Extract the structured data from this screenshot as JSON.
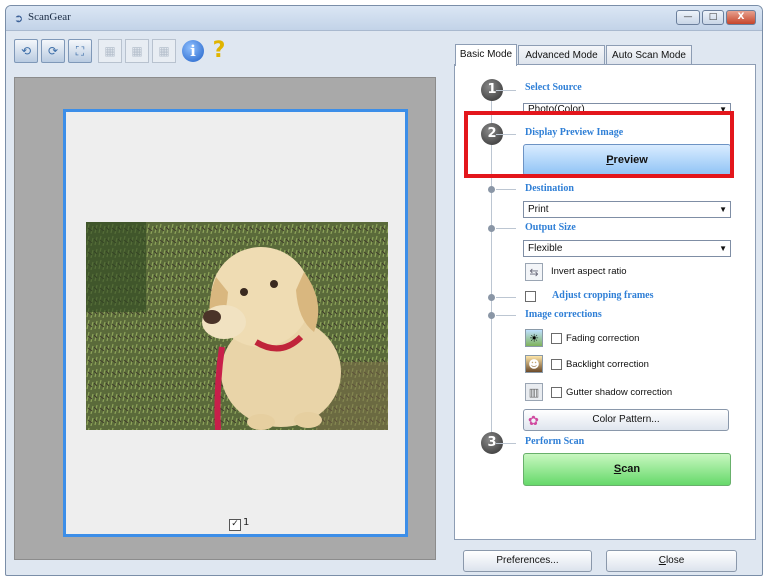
{
  "window": {
    "title": "ScanGear",
    "title_icon": "scanner-icon"
  },
  "title_buttons": {
    "minimize": "—",
    "maximize": "□",
    "close": "X"
  },
  "toolbar": {
    "icons": [
      "rotate-left-icon",
      "rotate-right-icon",
      "auto-crop-icon",
      "thumbnail-view-icon",
      "whole-image-view-icon",
      "clear-cropping-icon",
      "info-icon",
      "help-icon"
    ],
    "info_glyph": "i",
    "help_glyph": "?"
  },
  "preview": {
    "page_checkbox": "✓",
    "page_number": "1"
  },
  "tabs": [
    {
      "label": "Basic Mode",
      "active": true
    },
    {
      "label": "Advanced Mode",
      "active": false
    },
    {
      "label": "Auto Scan Mode",
      "active": false
    }
  ],
  "steps": {
    "one": "1",
    "two": "2",
    "three": "3"
  },
  "select_source": {
    "title": "Select Source",
    "value": "Photo(Color)"
  },
  "display_preview": {
    "title": "Display Preview Image",
    "button_label": "review",
    "button_underline": "P"
  },
  "destination": {
    "title": "Destination",
    "value": "Print"
  },
  "output_size": {
    "title": "Output Size",
    "value": "Flexible",
    "invert_label": "Invert aspect ratio"
  },
  "adjust_cropping": {
    "label": "Adjust cropping frames"
  },
  "image_corrections": {
    "title": "Image corrections",
    "fading": "Fading correction",
    "backlight": "Backlight correction",
    "gutter": "Gutter shadow correction",
    "color_pattern": "Color Pattern..."
  },
  "perform_scan": {
    "title": "Perform Scan",
    "button_label": "can",
    "button_underline": "S"
  },
  "bottom": {
    "preferences": "Preferences...",
    "close": "lose",
    "close_underline": "C"
  },
  "colors": {
    "accent_blue": "#2f7fd6",
    "highlight_red": "#e3161c",
    "scan_green": "#66d96a"
  }
}
